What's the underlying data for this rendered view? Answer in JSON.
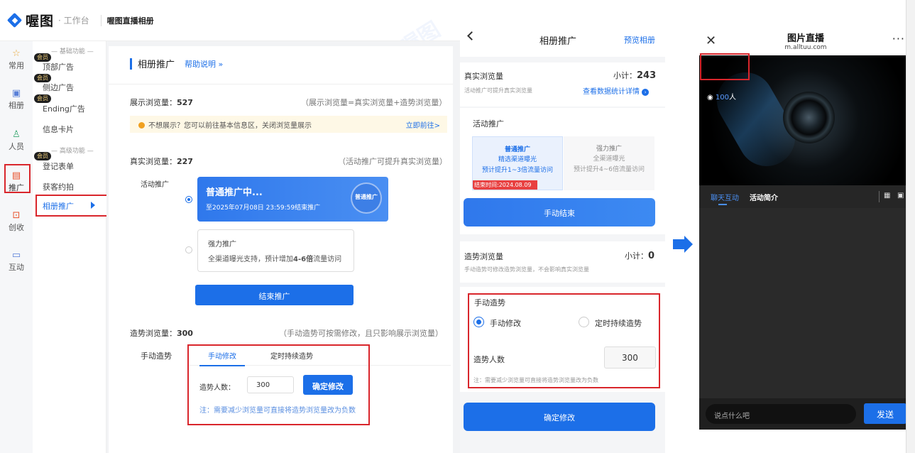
{
  "topbar": {
    "logo": "喔图",
    "workbench": "· 工作台",
    "album": "喔图直播相册"
  },
  "rail": {
    "items": [
      {
        "label": "常用",
        "icon": "star-icon"
      },
      {
        "label": "相册",
        "icon": "image-icon"
      },
      {
        "label": "人员",
        "icon": "people-icon"
      },
      {
        "label": "推广",
        "icon": "promotion-icon"
      },
      {
        "label": "创收",
        "icon": "income-icon"
      },
      {
        "label": "互动",
        "icon": "chat-icon"
      }
    ]
  },
  "subnav": {
    "basic_group": "— 基础功能 —",
    "advanced_group": "— 高级功能 —",
    "member_badge": "会员",
    "items": [
      "顶部广告",
      "侧边广告",
      "Ending广告",
      "信息卡片",
      "登记表单",
      "获客约拍",
      "相册推广"
    ]
  },
  "main": {
    "title": "相册推广",
    "help": "帮助说明 »",
    "display_label": "展示浏览量：",
    "display_value": "527",
    "display_note": "（展示浏览量=真实浏览量+造势浏览量）",
    "tip_text": "不想展示？您可以前往基本信息区，关闭浏览量展示",
    "tip_link": "立即前往>",
    "real_label": "真实浏览量：",
    "real_value": "227",
    "real_note": "（活动推广可提升真实浏览量）",
    "activity_label": "活动推广",
    "normal_title": "普通推广中...",
    "normal_sub": "至2025年07月08日 23:59:59结束推广",
    "normal_badge": "普通推广",
    "strong_title": "强力推广",
    "strong_sub_a": "全渠道曝光支持，预计增加",
    "strong_sub_b": "4-6倍",
    "strong_sub_c": "流量访问",
    "end_button": "结束推广",
    "hype_label": "造势浏览量：",
    "hype_value": "300",
    "hype_note": "（手动造势可按需修改，且只影响展示浏览量）",
    "manual_label": "手动造势",
    "tab_manual": "手动修改",
    "tab_timed": "定时持续造势",
    "hype_count_label": "造势人数：",
    "hype_count_value": "300",
    "confirm_button": "确定修改",
    "footnote": "注：需要减少浏览量可直接将造势浏览量改为负数"
  },
  "mobile1": {
    "title": "相册推广",
    "preview": "预览相册",
    "real_label": "真实浏览量",
    "subtotal_label": "小计：",
    "real_subtotal": "243",
    "real_hint": "活动推广可提升真实浏览量",
    "stats_link": "查看数据统计详情",
    "activity_label": "活动推广",
    "normal_title": "普通推广",
    "normal_line1": "精选渠道曝光",
    "normal_line2": "预计提升1~3倍流量访问",
    "normal_end": "结束时间:2024.08.09",
    "strong_title": "强力推广",
    "strong_line1": "全渠道曝光",
    "strong_line2": "预计提升4~6倍流量访问",
    "manual_end_button": "手动结束",
    "hype_label": "造势浏览量",
    "hype_subtotal": "0",
    "hype_hint": "手动造势可修改造势浏览量，不会影响真实浏览量",
    "manual_label": "手动造势",
    "opt_manual": "手动修改",
    "opt_timed": "定时持续造势",
    "count_label": "造势人数",
    "count_value": "300",
    "footnote": "注：需要减少浏览量可直接将造势浏览量改为负数",
    "confirm_button": "确定修改"
  },
  "mobile2": {
    "title": "图片直播",
    "url": "m.alltuu.com",
    "viewer_count": "100",
    "viewer_unit": "人",
    "tab_chat": "聊天互动",
    "tab_intro": "活动简介",
    "chat_placeholder": "说点什么吧",
    "send": "发送"
  },
  "watermark": "喔图",
  "colors": {
    "accent": "#1c6fe8",
    "highlight": "#d9262c",
    "end_tag": "#e84040"
  }
}
